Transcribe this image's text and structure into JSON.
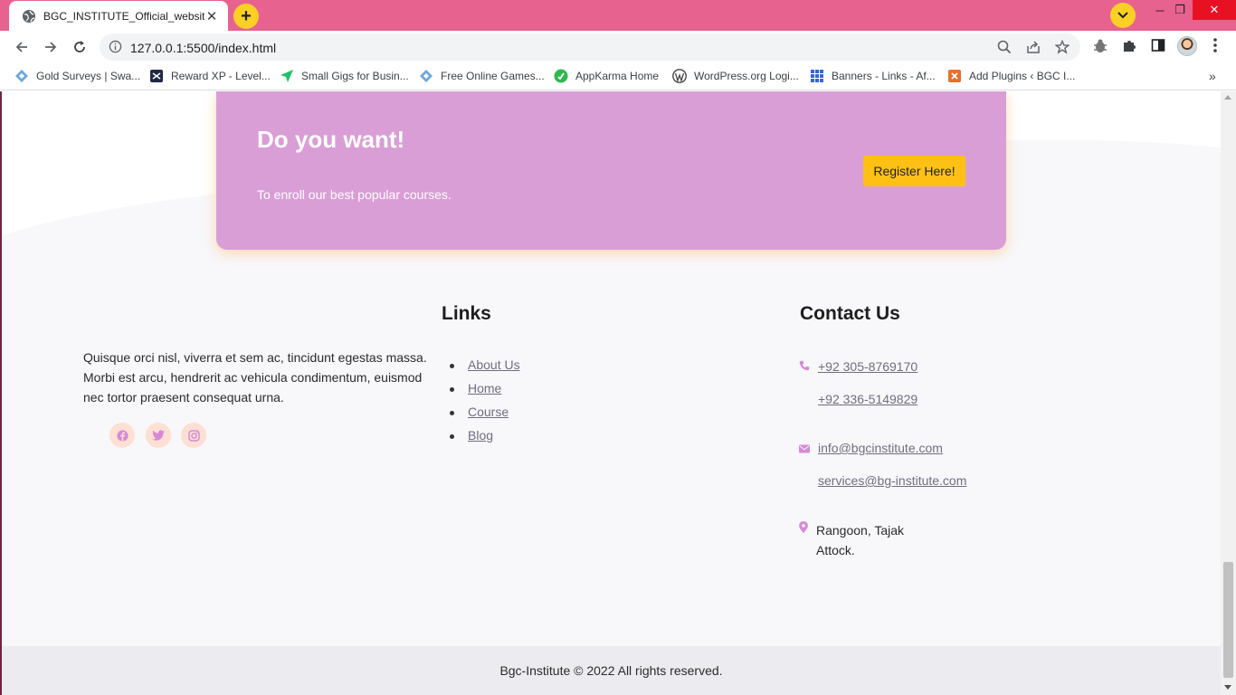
{
  "browser": {
    "tab_title": "BGC_INSTITUTE_Official_website",
    "url": "127.0.0.1:5500/index.html",
    "tab_close": "✕",
    "new_tab": "+",
    "win_min": "─",
    "win_max": "❐",
    "win_close": "✕",
    "bookmarks_more": "»",
    "bookmarks": [
      {
        "label": "Gold Surveys | Swa...",
        "icon": "diamond-icon"
      },
      {
        "label": "Reward XP - Level...",
        "icon": "rewardxp-icon"
      },
      {
        "label": "Small Gigs for Busin...",
        "icon": "send-icon"
      },
      {
        "label": "Free Online Games...",
        "icon": "diamond-icon"
      },
      {
        "label": "AppKarma Home",
        "icon": "appkarma-icon"
      },
      {
        "label": "WordPress.org Logi...",
        "icon": "wordpress-icon"
      },
      {
        "label": "Banners - Links - Af...",
        "icon": "grid-icon"
      },
      {
        "label": "Add Plugins ‹ BGC I...",
        "icon": "plugin-icon"
      }
    ]
  },
  "page": {
    "cta": {
      "title": "Do you want!",
      "subtitle": "To enroll our best popular courses.",
      "button": "Register Here!"
    },
    "about": {
      "text": "Quisque orci nisl, viverra et sem ac, tincidunt egestas massa. Morbi est arcu, hendrerit ac vehicula condimentum, euismod nec tortor praesent consequat urna."
    },
    "social": [
      "facebook-icon",
      "twitter-icon",
      "instagram-icon"
    ],
    "links": {
      "title": "Links",
      "items": [
        "About Us",
        "Home",
        "Course",
        "Blog"
      ]
    },
    "contact": {
      "title": "Contact Us",
      "phone1": "+92 305-8769170",
      "phone2": "+92 336-5149829",
      "email1": "info@bgcinstitute.com",
      "email2": "services@bg-institute.com",
      "address_line1": "Rangoon, Tajak",
      "address_line2": "Attock."
    },
    "footer": "Bgc-Institute © 2022 All rights reserved."
  },
  "colors": {
    "tab_bar": "#e8628f",
    "cta_bg": "#da9ed6",
    "cta_button": "#fec015",
    "page_bg": "#f8f7fa",
    "footer_bg": "#ececf0",
    "accent_icon": "#d58ad6"
  }
}
